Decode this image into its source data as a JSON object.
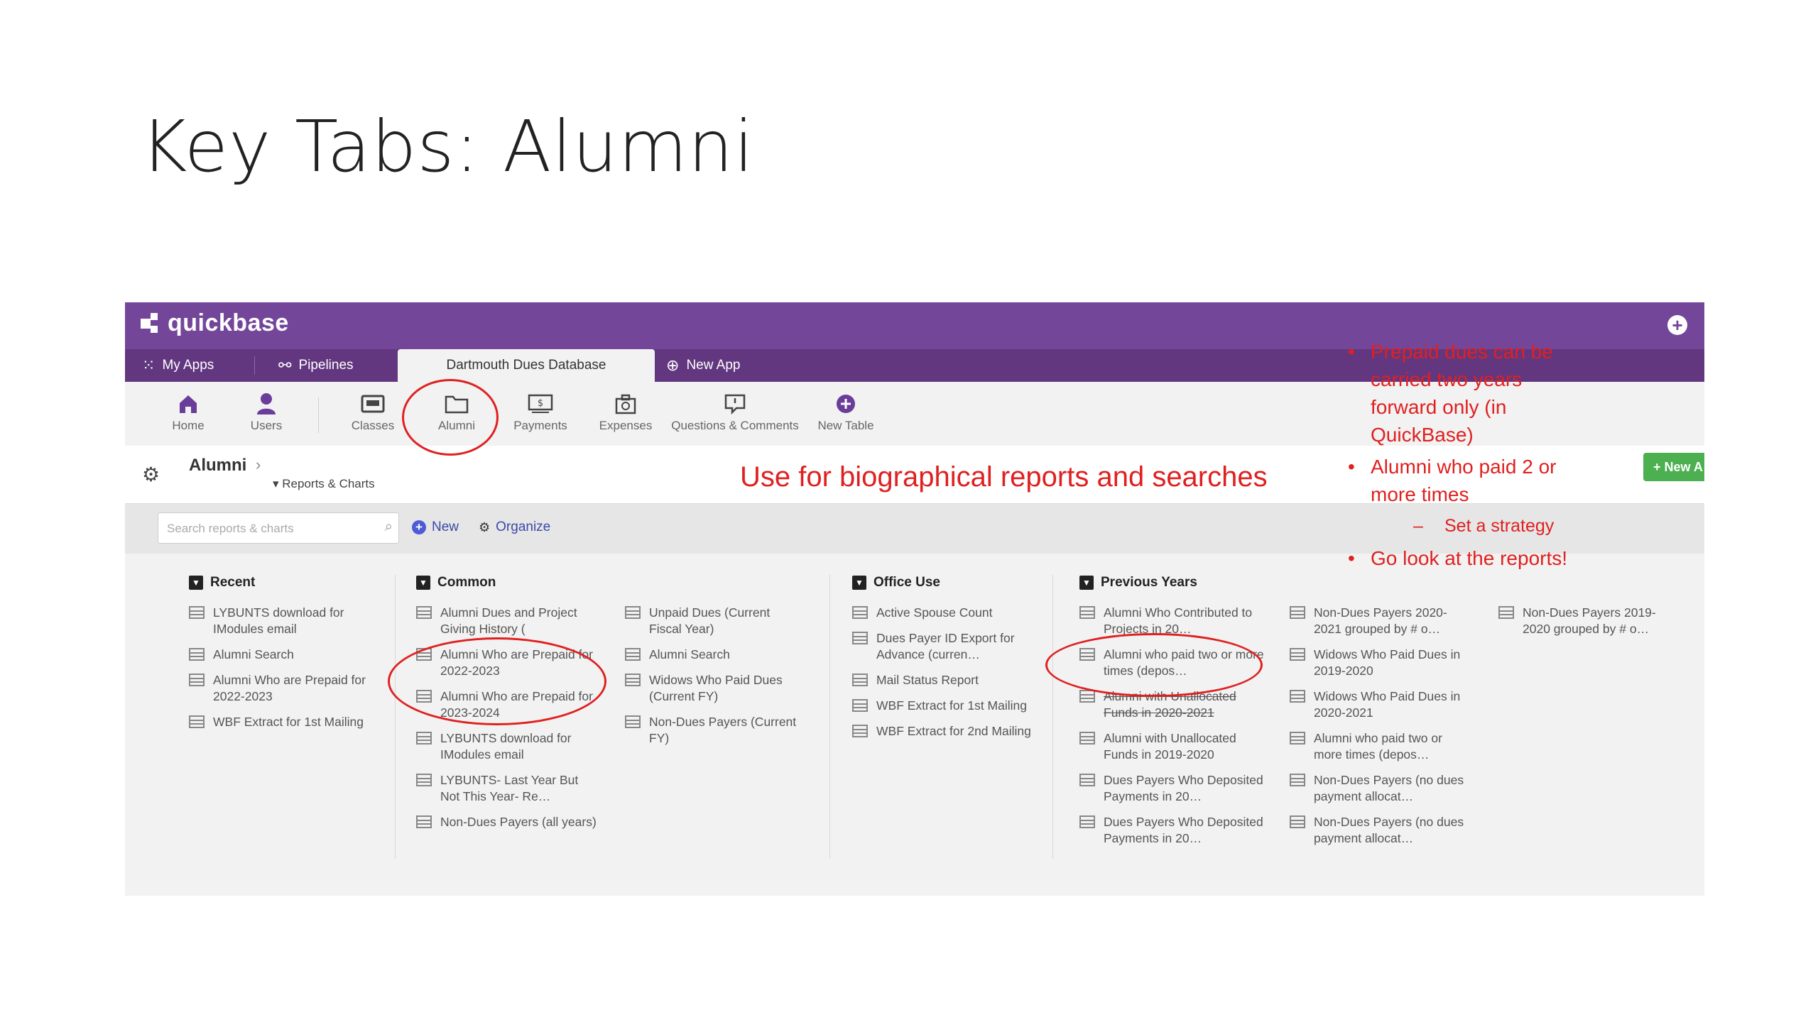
{
  "slide": {
    "title": "Key Tabs:  Alumni"
  },
  "app": {
    "logo_text": "quickbase",
    "top_tabs": [
      {
        "label": "My Apps",
        "icon": "grid-icon"
      },
      {
        "label": "Pipelines",
        "icon": "pipelines-icon"
      },
      {
        "label": "Dartmouth Dues Database",
        "icon": ""
      },
      {
        "label": "New App",
        "icon": "new-app-icon"
      }
    ],
    "tables": [
      {
        "label": "Home",
        "icon": "home-icon"
      },
      {
        "label": "Users",
        "icon": "user-icon"
      },
      {
        "label": "Classes",
        "icon": "classes-icon"
      },
      {
        "label": "Alumni",
        "icon": "folder-icon"
      },
      {
        "label": "Payments",
        "icon": "payment-icon"
      },
      {
        "label": "Expenses",
        "icon": "expenses-icon"
      },
      {
        "label": "Questions & Comments",
        "icon": "comment-icon"
      },
      {
        "label": "New Table",
        "icon": "plus-circle-icon"
      }
    ],
    "page": {
      "name": "Alumni",
      "reports_link": "Reports & Charts",
      "new_button": "+ New A"
    },
    "search": {
      "placeholder": "Search reports & charts",
      "new_label": "New",
      "organize_label": "Organize"
    },
    "groups": {
      "recent": {
        "title": "Recent",
        "items": [
          "LYBUNTS download for IModules email",
          "Alumni Search",
          "Alumni Who are Prepaid for 2022-2023",
          "WBF Extract for 1st Mailing"
        ]
      },
      "common": {
        "title": "Common",
        "items_a": [
          "Alumni Dues and Project Giving History (",
          "Alumni Who are Prepaid for 2022-2023",
          "Alumni Who are Prepaid for 2023-2024",
          "LYBUNTS download for IModules email",
          "LYBUNTS- Last Year But Not This Year- Re…",
          "Non-Dues Payers (all years)"
        ],
        "items_b": [
          "Unpaid Dues (Current Fiscal Year)",
          "Alumni Search",
          "Widows Who Paid Dues (Current FY)",
          "Non-Dues Payers (Current FY)"
        ]
      },
      "office": {
        "title": "Office Use",
        "items": [
          "Active Spouse Count",
          "Dues Payer ID Export for Advance (curren…",
          "Mail Status Report",
          "WBF Extract for 1st Mailing",
          "WBF Extract for 2nd Mailing"
        ]
      },
      "previous": {
        "title": "Previous Years",
        "items_a": [
          "Alumni Who Contributed to Projects in 20…",
          "Alumni who paid two or more times (depos…",
          "Alumni with Unallocated Funds in 2020-2021",
          "Alumni with Unallocated Funds in 2019-2020",
          "Dues Payers Who Deposited Payments in 20…",
          "Dues Payers Who Deposited Payments in 20…"
        ],
        "items_b": [
          "Non-Dues Payers 2020-2021 grouped by # o…",
          "Widows Who Paid Dues in 2019-2020",
          "Widows Who Paid Dues in 2020-2021",
          "Alumni who paid two or more times (depos…",
          "Non-Dues Payers (no dues payment allocat…",
          "Non-Dues Payers (no dues payment allocat…"
        ],
        "items_c": [
          "Non-Dues Payers 2019-2020 grouped by # o…"
        ]
      }
    }
  },
  "annotations": {
    "banner": "Use for biographical reports and searches",
    "bullets": [
      {
        "text": "Prepaid dues can be carried two years forward only (in QuickBase)",
        "marker": "•"
      },
      {
        "text": "Alumni who paid 2 or more times",
        "marker": "•"
      },
      {
        "text": "Set a strategy",
        "marker": "–"
      },
      {
        "text": "Go look at the reports!",
        "marker": "•"
      }
    ],
    "color": "#e02020"
  },
  "colors": {
    "brand": "#74469a",
    "tabbar": "#62377f",
    "link": "#3a4aa8",
    "new_button": "#4caf50"
  }
}
